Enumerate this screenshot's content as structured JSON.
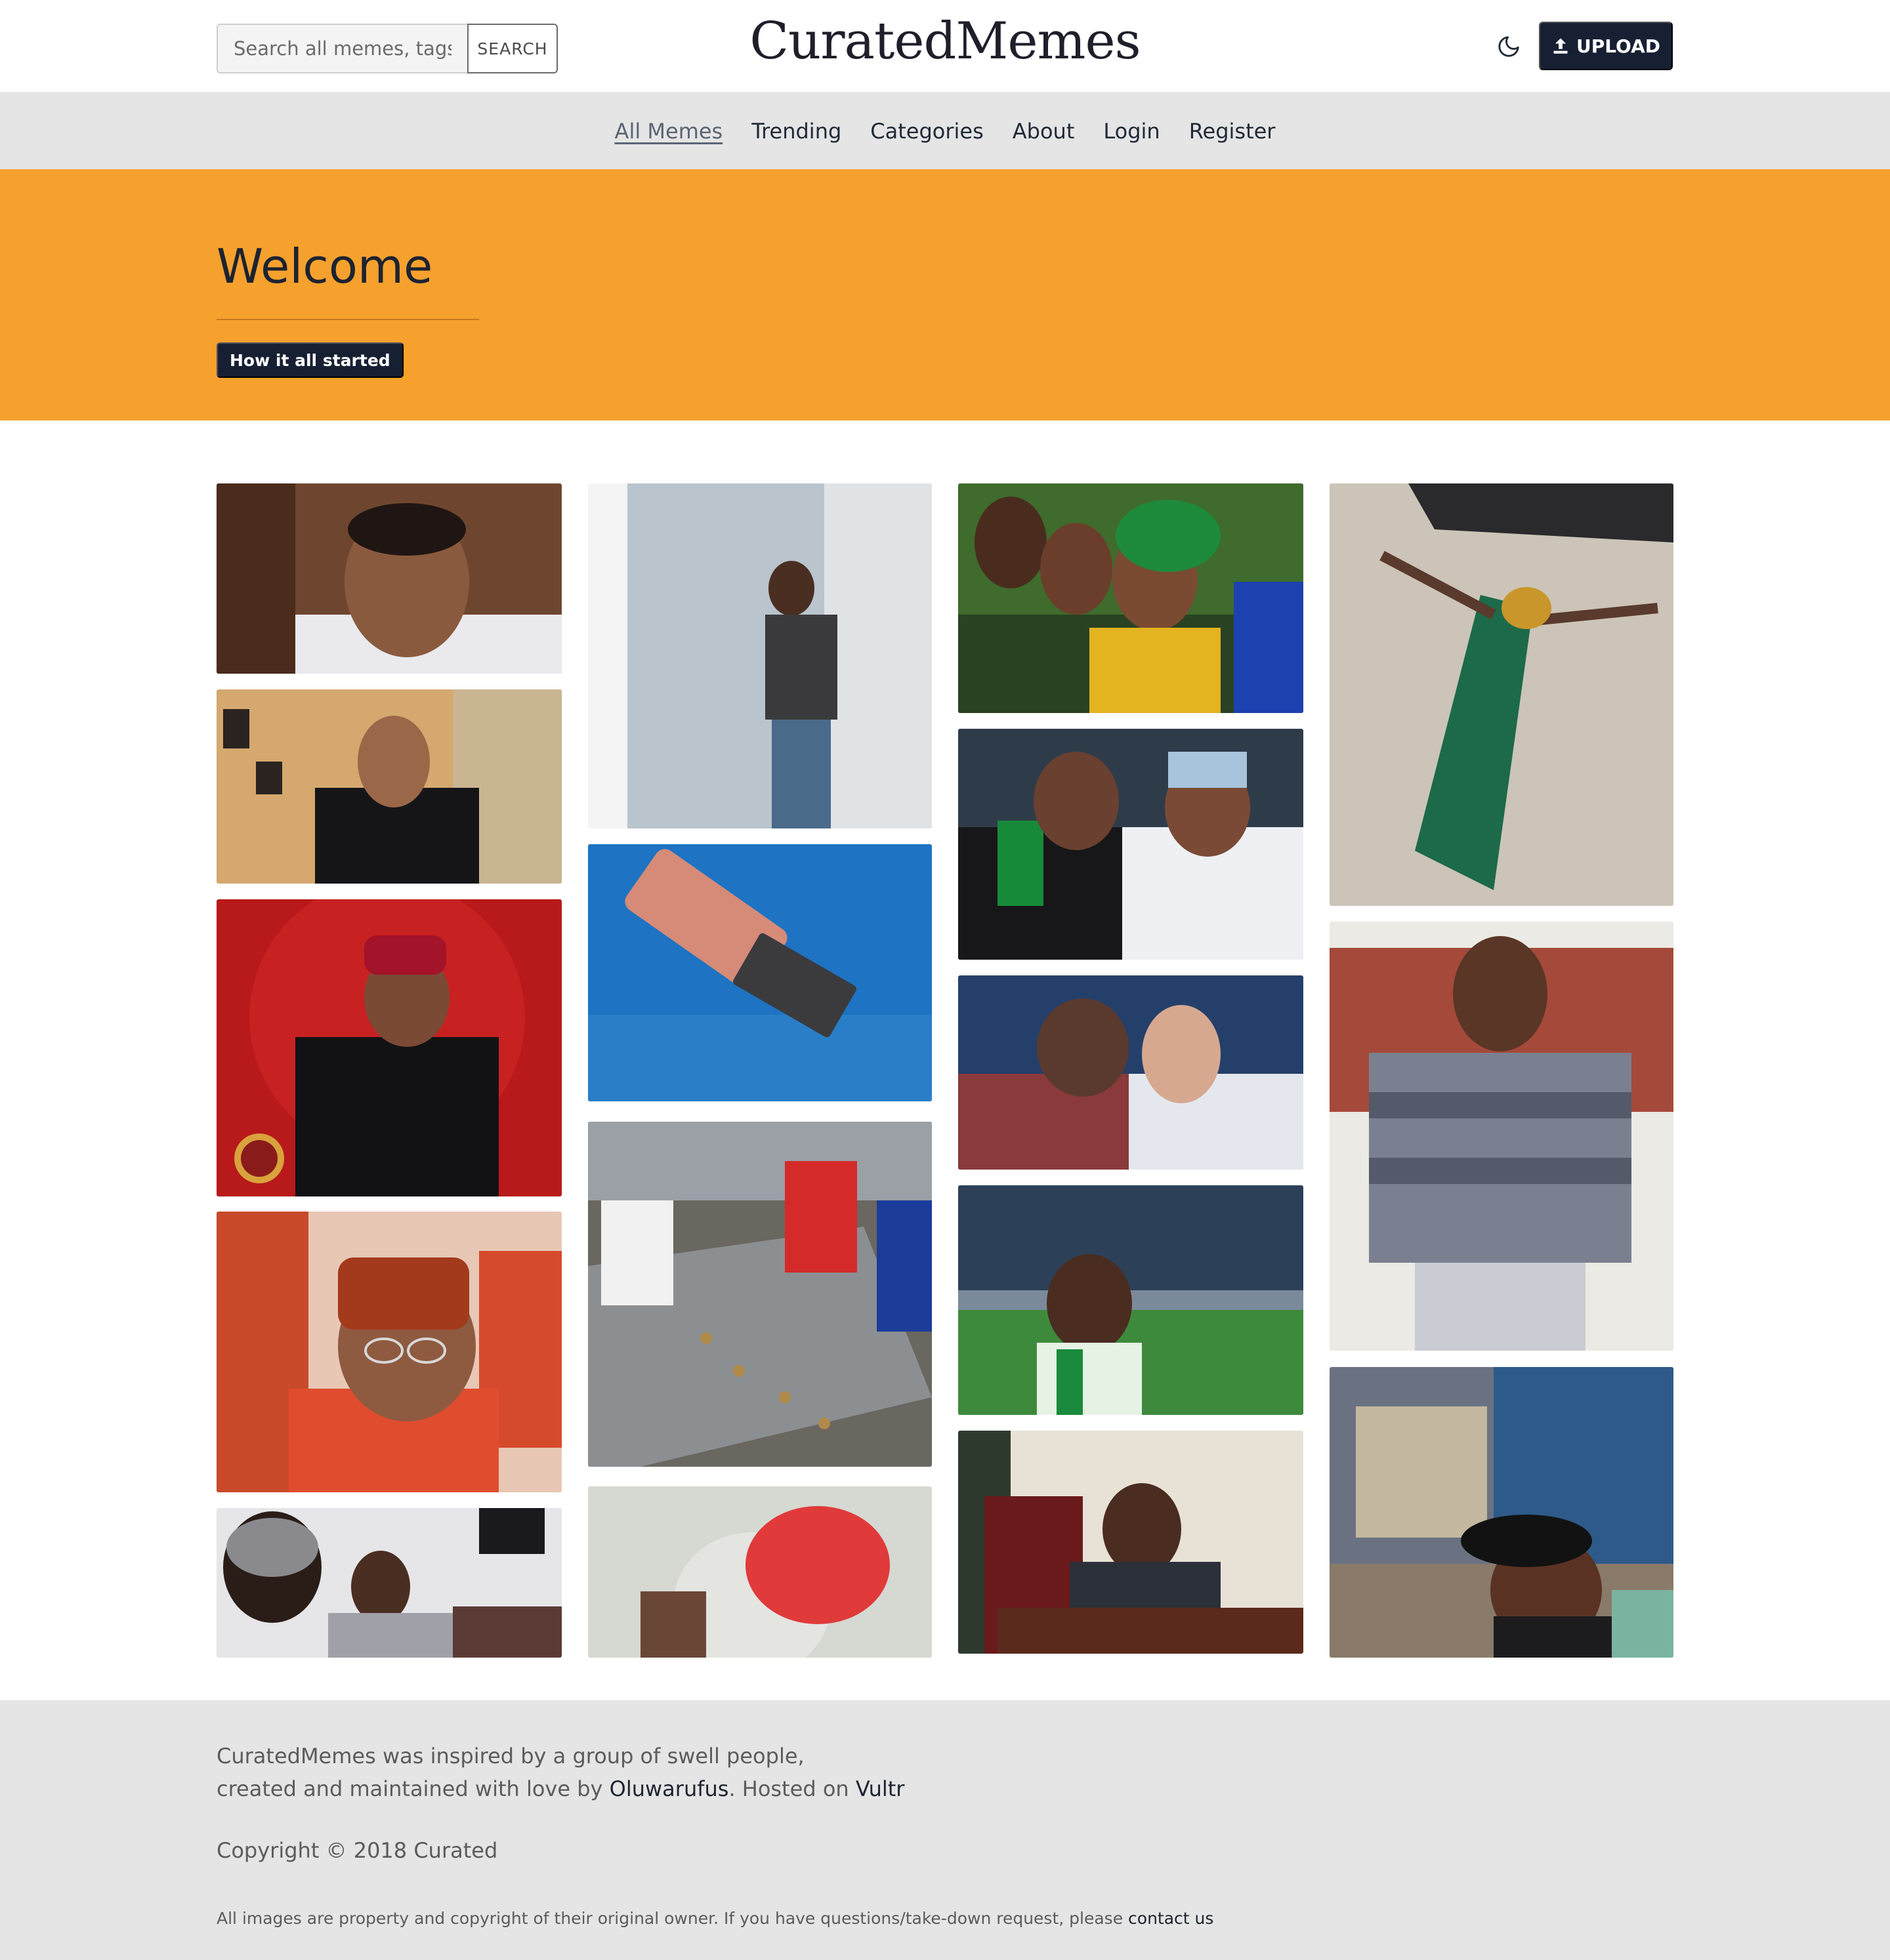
{
  "header": {
    "search_placeholder": "Search all memes, tags",
    "search_button": "SEARCH",
    "site_title": "CuratedMemes",
    "theme_toggle_icon": "moon-icon",
    "upload_icon": "upload-icon",
    "upload_label": "UPLOAD"
  },
  "nav": {
    "items": [
      {
        "label": "All Memes",
        "active": true
      },
      {
        "label": "Trending"
      },
      {
        "label": "Categories"
      },
      {
        "label": "About"
      },
      {
        "label": "Login"
      },
      {
        "label": "Register"
      }
    ]
  },
  "hero": {
    "title": "Welcome",
    "button": "How it all started"
  },
  "footer": {
    "line1": "CuratedMemes was inspired by a group of swell people,",
    "line2_prefix": "created and maintained with love by ",
    "author": "Oluwarufus",
    "line2_middle": ". Hosted on ",
    "host": "Vultr",
    "copyright": "Copyright © 2018 Curated",
    "disclaimer": "All images are property and copyright of their original owner. If you have questions/take-down request, please ",
    "contact": "contact us"
  },
  "colors": {
    "hero": "#f6a12e",
    "primary_button": "#172033",
    "nav_bg": "#e5e5e5",
    "footer_bg": "#e5e5e5"
  }
}
